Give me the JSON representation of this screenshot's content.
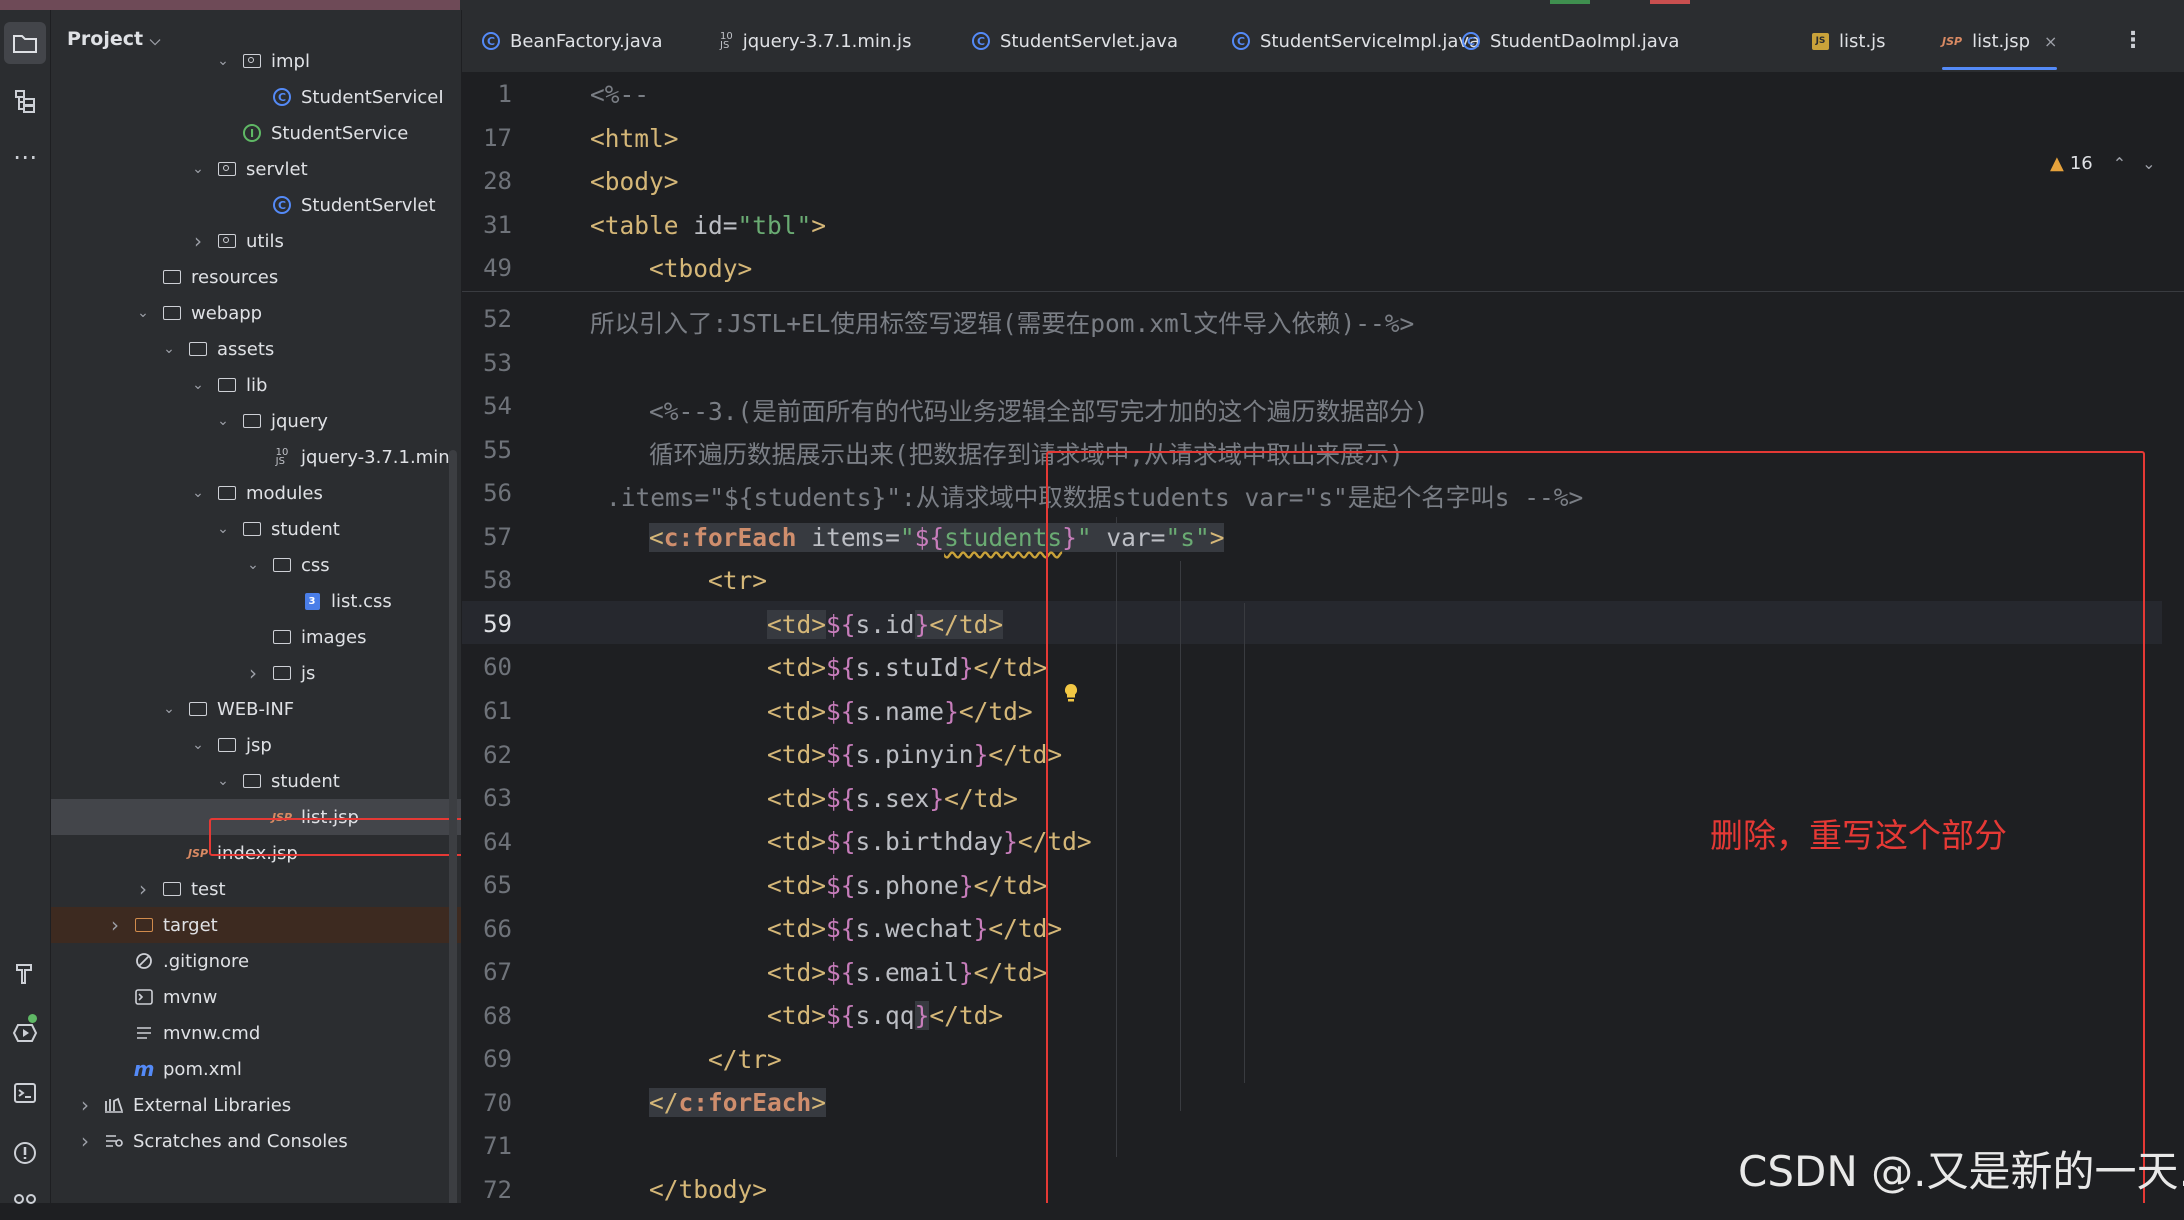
{
  "colors": {
    "accent": "#548af7",
    "highlight_red": "#e53935",
    "folder_orange": "#d18b4c"
  },
  "sidebar": {
    "title": "Project",
    "items": [
      {
        "label": "impl",
        "kind": "package",
        "chev": "down"
      },
      {
        "label": "StudentServiceI",
        "kind": "class"
      },
      {
        "label": "StudentService",
        "kind": "interface"
      },
      {
        "label": "servlet",
        "kind": "package",
        "chev": "down"
      },
      {
        "label": "StudentServlet",
        "kind": "class"
      },
      {
        "label": "utils",
        "kind": "package",
        "chev": "right"
      },
      {
        "label": "resources",
        "kind": "folder"
      },
      {
        "label": "webapp",
        "kind": "folder",
        "chev": "down"
      },
      {
        "label": "assets",
        "kind": "folder",
        "chev": "down"
      },
      {
        "label": "lib",
        "kind": "folder",
        "chev": "down"
      },
      {
        "label": "jquery",
        "kind": "folder",
        "chev": "down"
      },
      {
        "label": "jquery-3.7.1.min",
        "kind": "jsfile"
      },
      {
        "label": "modules",
        "kind": "folder",
        "chev": "down"
      },
      {
        "label": "student",
        "kind": "folder",
        "chev": "down"
      },
      {
        "label": "css",
        "kind": "folder",
        "chev": "down"
      },
      {
        "label": "list.css",
        "kind": "cssfile"
      },
      {
        "label": "images",
        "kind": "folder"
      },
      {
        "label": "js",
        "kind": "folder",
        "chev": "right"
      },
      {
        "label": "WEB-INF",
        "kind": "folder",
        "chev": "down"
      },
      {
        "label": "jsp",
        "kind": "folder",
        "chev": "down"
      },
      {
        "label": "student",
        "kind": "folder",
        "chev": "down"
      },
      {
        "label": "list.jsp",
        "kind": "jspfile",
        "selected": true
      },
      {
        "label": "index.jsp",
        "kind": "jspfile"
      },
      {
        "label": "test",
        "kind": "folder",
        "chev": "right"
      },
      {
        "label": "target",
        "kind": "folder-orange",
        "chev": "right"
      },
      {
        "label": ".gitignore",
        "kind": "ignore"
      },
      {
        "label": "mvnw",
        "kind": "terminal"
      },
      {
        "label": "mvnw.cmd",
        "kind": "lines"
      },
      {
        "label": "pom.xml",
        "kind": "maven"
      },
      {
        "label": "External Libraries",
        "kind": "libs",
        "chev": "right"
      },
      {
        "label": "Scratches and Consoles",
        "kind": "scratch",
        "chev": "right"
      }
    ]
  },
  "tabs": [
    {
      "label": "BeanFactory.java",
      "icon": "class-icon"
    },
    {
      "label": "jquery-3.7.1.min.js",
      "icon": "js-file-icon"
    },
    {
      "label": "StudentServlet.java",
      "icon": "class-icon"
    },
    {
      "label": "StudentServiceImpl.java",
      "icon": "class-icon"
    },
    {
      "label": "StudentDaoImpl.java",
      "icon": "class-icon"
    },
    {
      "label": "list.js",
      "icon": "js-badge-icon"
    },
    {
      "label": "list.jsp",
      "icon": "jsp-icon",
      "active": true,
      "close": "×"
    }
  ],
  "editor": {
    "warning_count": "16",
    "sticky_lines": [
      "1",
      "17",
      "28",
      "31",
      "49"
    ],
    "line_numbers": [
      "52",
      "53",
      "54",
      "55",
      "56",
      "57",
      "58",
      "59",
      "60",
      "61",
      "62",
      "63",
      "64",
      "65",
      "66",
      "67",
      "68",
      "69",
      "70",
      "71",
      "72"
    ],
    "current_line": "59",
    "comment_52": "所以引入了:JSTL+EL使用标签写逻辑(需要在pom.xml文件导入依赖)--%>",
    "comment_54": "<%--3.(是前面所有的代码业务逻辑全部写完才加的这个遍历数据部分)",
    "comment_55": "循环遍历数据展示出来(把数据存到请求域中,从请求域中取出来展示)",
    "comment_56": ".items=\"${students}\":从请求域中取数据students var=\"s\"是起个名字叫s --%>",
    "annotation": "删除，重写这个部分"
  },
  "watermark": "CSDN @.又是新的一天."
}
